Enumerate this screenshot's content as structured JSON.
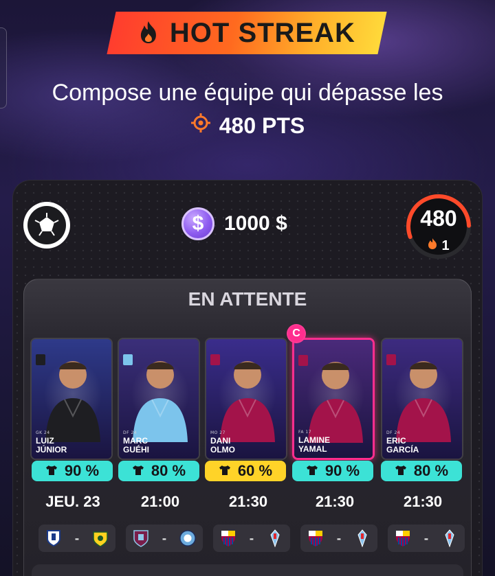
{
  "banner": {
    "title": "HOT STREAK"
  },
  "challenge": {
    "line1": "Compose une équipe qui dépasse les",
    "target": "480 PTS"
  },
  "budget": {
    "symbol": "$",
    "amount": "1000 $"
  },
  "score": {
    "value": "480",
    "streak": "1",
    "gauge_fraction": 0.55,
    "gauge_color": "#ff4a2a"
  },
  "pending": {
    "title": "EN ATTENTE"
  },
  "players": [
    {
      "name1": "LUIZ",
      "name2": "JÚNIOR",
      "pos": "GK",
      "age": "24",
      "percent": "90 %",
      "pct_color": "teal",
      "time": "JEU. 23",
      "captain": false,
      "bg": "#2e3a8a",
      "shirt": "#1e1e22"
    },
    {
      "name1": "MARC",
      "name2": "GUÉHI",
      "pos": "DF",
      "age": "24",
      "percent": "80 %",
      "pct_color": "teal",
      "time": "21:00",
      "captain": false,
      "bg": "#3b2f7a",
      "shirt": "#7cc4ec"
    },
    {
      "name1": "DANI",
      "name2": "OLMO",
      "pos": "MO",
      "age": "27",
      "percent": "60 %",
      "pct_color": "yellow",
      "time": "21:30",
      "captain": false,
      "bg": "#3a2d8c",
      "shirt": "#a3134a"
    },
    {
      "name1": "LAMINE",
      "name2": "YAMAL",
      "pos": "FA",
      "age": "17",
      "percent": "90 %",
      "pct_color": "teal",
      "time": "21:30",
      "captain": true,
      "captain_label": "C",
      "bg": "#4a2a7a",
      "shirt": "#a3134a"
    },
    {
      "name1": "ERIC",
      "name2": "GARCÍA",
      "pos": "DF",
      "age": "24",
      "percent": "80 %",
      "pct_color": "teal",
      "time": "21:30",
      "captain": false,
      "bg": "#3d2b80",
      "shirt": "#a3134a"
    }
  ],
  "matches": [
    {
      "home": "oviedo-crest",
      "away": "villarreal-crest",
      "sep": "-"
    },
    {
      "home": "burnley-crest",
      "away": "man-city-crest",
      "sep": "-"
    },
    {
      "home": "barcelona-crest",
      "away": "celta-crest",
      "sep": "-"
    },
    {
      "home": "barcelona-crest",
      "away": "celta-crest",
      "sep": "-"
    },
    {
      "home": "barcelona-crest",
      "away": "celta-crest",
      "sep": "-"
    }
  ],
  "colors": {
    "accent_orange": "#ff6a1f",
    "captain_pink": "#ff2e8e",
    "teal": "#3ce2d6",
    "yellow": "#ffd328",
    "coin_purple": "#8e5cf0"
  }
}
